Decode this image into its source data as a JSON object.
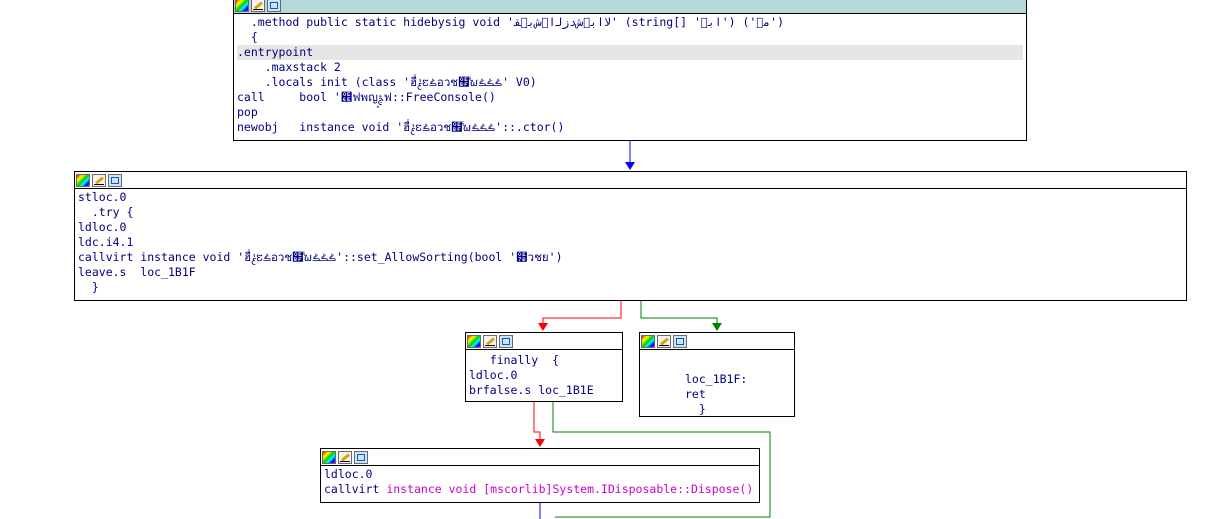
{
  "icons": [
    "color-palette-icon",
    "rename-pencil-icon",
    "group-nodes-icon"
  ],
  "colors": {
    "text": "#000080",
    "library_ref": "#cc00cc",
    "edge_flow": "#0000ff",
    "edge_false": "#ff0000",
    "edge_true": "#008000",
    "node_header_active": "#b5d8d8",
    "highlight_line": "#e6e6e6"
  },
  "nodes": {
    "main": {
      "lines": [
        "  .method public static hidebysig void 'ﻻﺍﺑ۪ﺵﺩﺯﻟﺍ۪ﺵﺑ۪ﻘ' (string[] 'ﺍﺑ۪') ('ﻣ۪')",
        "  {",
        ".entrypoint",
        "    .maxstack 2",
        "    .locals init (class 'ฮื่ࣃຬࣈอวช຿࣋ຆࣈࣈࣈ' V0)",
        "call     bool '๮ฟพญ࣒ࣅฟ::FreeConsole()",
        "pop",
        "newobj   instance void 'ฮื่ࣃຬࣈอวช຿࣋ຆࣈࣈࣈ'::.ctor()"
      ]
    },
    "try_block": {
      "lines": [
        "stloc.0",
        "  .try {",
        "ldloc.0",
        "ldc.i4.1",
        "callvirt instance void 'ฮื่ࣃຬࣈอวช຿࣋ຆࣈࣈࣈ'::set_AllowSorting(bool '๻วชย')",
        "leave.s  loc_1B1F",
        "  }"
      ]
    },
    "finally_block": {
      "lines": [
        "   finally  {",
        "ldloc.0",
        "brfalse.s loc_1B1E"
      ]
    },
    "ret_block": {
      "lines": [
        "",
        "loc_1B1F:",
        "ret",
        "  }"
      ]
    },
    "dispose_block": {
      "line1": "ldloc.0",
      "line2_prefix": "callvirt ",
      "line2_lib": "instance void [mscorlib]System.IDisposable::Dispose()"
    }
  }
}
